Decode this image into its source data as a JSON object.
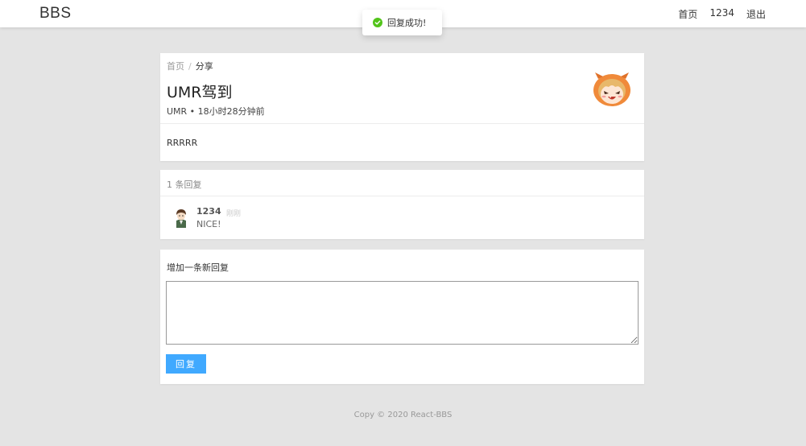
{
  "header": {
    "logo": "BBS",
    "nav": {
      "home": "首页",
      "user": "1234",
      "logout": "退出"
    }
  },
  "toast": {
    "message": "回复成功!",
    "icon": "check-circle-icon",
    "color": "#52c41a"
  },
  "topic": {
    "breadcrumb": {
      "home": "首页",
      "separator": "/",
      "current": "分享"
    },
    "title": "UMR驾到",
    "meta": "UMR • 18小时28分钟前",
    "body": "RRRRR",
    "avatar": "anime-girl-avatar"
  },
  "replies": {
    "count_label": "1 条回复",
    "items": [
      {
        "author": "1234",
        "time": "刚刚",
        "content": "NICE!",
        "avatar": "boy-avatar"
      }
    ]
  },
  "new_reply": {
    "title": "增加一条新回复",
    "textarea_value": "",
    "button_label": "回复",
    "button_color": "#40a9ff"
  },
  "footer": {
    "text": "Copy © 2020 React-BBS"
  }
}
